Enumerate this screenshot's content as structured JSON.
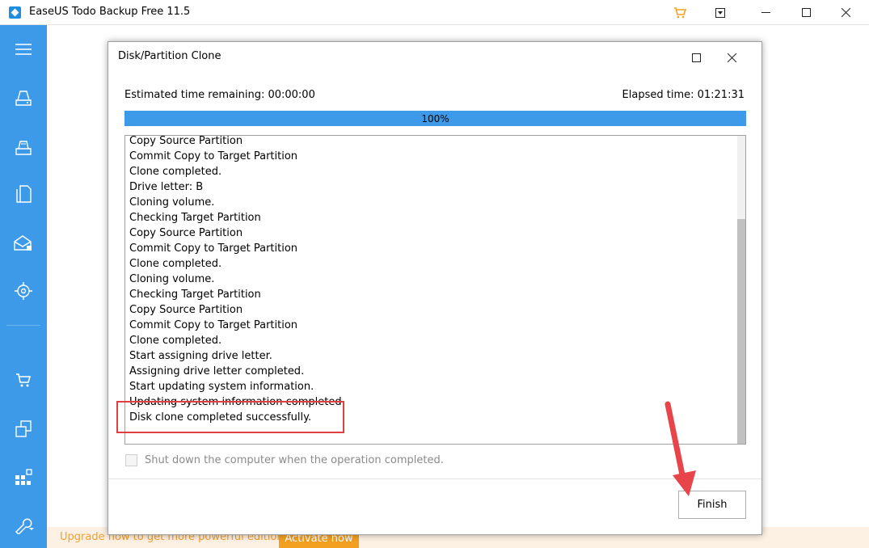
{
  "window": {
    "title": "EaseUS Todo Backup Free 11.5",
    "colors": {
      "sidebar": "#3d9ae8",
      "accent": "#f3a021",
      "highlight": "#e04040"
    }
  },
  "sidebar": {
    "icons": [
      "menu-icon",
      "disk-backup-icon",
      "system-backup-icon",
      "file-backup-icon",
      "mail-backup-icon",
      "smart-backup-icon",
      "cart-icon",
      "clone-icon",
      "windows-tools-icon",
      "tools-wrench-icon"
    ]
  },
  "dialog": {
    "title": "Disk/Partition Clone",
    "estimated_time": "Estimated time remaining: 00:00:00",
    "elapsed_time": "Elapsed time: 01:21:31",
    "progress": {
      "percent": 100,
      "label": "100%"
    },
    "log": [
      "Copy Source Partition",
      "Commit Copy to Target Partition",
      "Clone completed.",
      "Drive letter: B",
      "Cloning volume.",
      "Checking Target Partition",
      "Copy Source Partition",
      "Commit Copy to Target Partition",
      "Clone completed.",
      "Cloning volume.",
      "Checking Target Partition",
      "Copy Source Partition",
      "Commit Copy to Target Partition",
      "Clone completed.",
      "Start assigning drive letter.",
      "Assigning drive letter completed.",
      "Start updating system information.",
      "Updating system information completed.",
      "Disk clone completed successfully."
    ],
    "shutdown_checkbox_label": "Shut down the computer when the operation completed.",
    "finish_label": "Finish"
  },
  "upgrade": {
    "text": "Upgrade now to get more powerful edition.",
    "activate_label": "Activate now"
  }
}
